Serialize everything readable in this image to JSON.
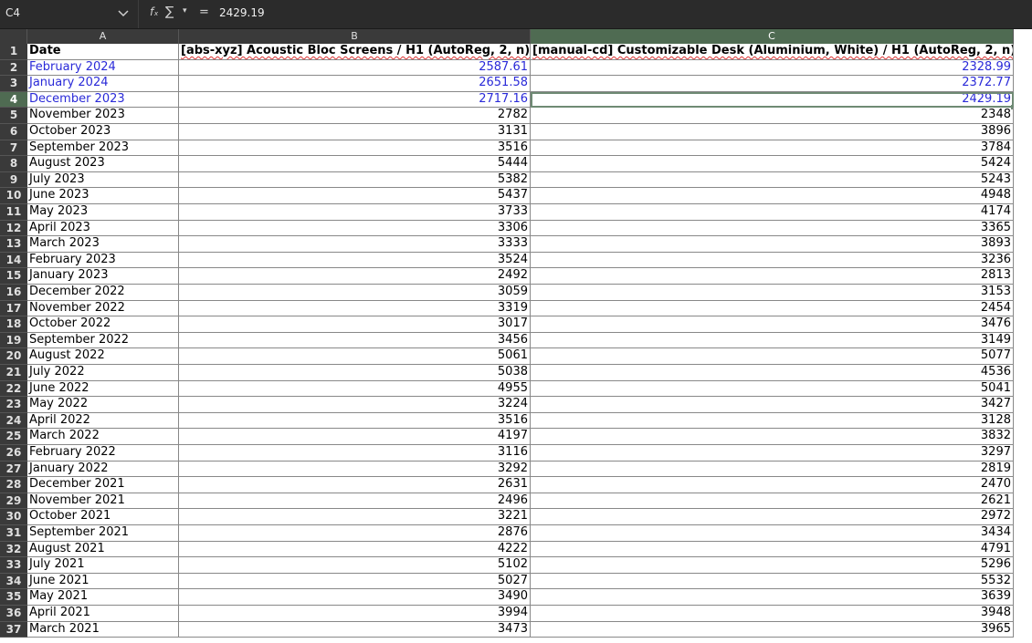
{
  "formula_bar": {
    "cell_ref": "C4",
    "fx_label": "fₓ",
    "sum_label": "∑",
    "sum_dropdown": "▾",
    "equals_label": "=",
    "formula_value": "2429.19"
  },
  "columns": [
    {
      "letter": "A",
      "selected": false
    },
    {
      "letter": "B",
      "selected": false
    },
    {
      "letter": "C",
      "selected": true
    }
  ],
  "header_row": {
    "a": "Date",
    "b": "[abs-xyz] Acoustic Bloc Screens / H1 (AutoReg, 2, n)",
    "c": "[manual-cd] Customizable Desk (Aluminium, White) / H1 (AutoReg, 2, n)"
  },
  "active_row": 4,
  "rows": [
    {
      "num": "2",
      "date": "February 2024",
      "b": "2587.61",
      "c": "2328.99",
      "blue": true
    },
    {
      "num": "3",
      "date": "January 2024",
      "b": "2651.58",
      "c": "2372.77",
      "blue": true
    },
    {
      "num": "4",
      "date": "December 2023",
      "b": "2717.16",
      "c": "2429.19",
      "blue": true
    },
    {
      "num": "5",
      "date": "November 2023",
      "b": "2782",
      "c": "2348",
      "blue": false
    },
    {
      "num": "6",
      "date": "October 2023",
      "b": "3131",
      "c": "3896",
      "blue": false
    },
    {
      "num": "7",
      "date": "September 2023",
      "b": "3516",
      "c": "3784",
      "blue": false
    },
    {
      "num": "8",
      "date": "August 2023",
      "b": "5444",
      "c": "5424",
      "blue": false
    },
    {
      "num": "9",
      "date": "July 2023",
      "b": "5382",
      "c": "5243",
      "blue": false
    },
    {
      "num": "10",
      "date": "June 2023",
      "b": "5437",
      "c": "4948",
      "blue": false
    },
    {
      "num": "11",
      "date": "May 2023",
      "b": "3733",
      "c": "4174",
      "blue": false
    },
    {
      "num": "12",
      "date": "April 2023",
      "b": "3306",
      "c": "3365",
      "blue": false
    },
    {
      "num": "13",
      "date": "March 2023",
      "b": "3333",
      "c": "3893",
      "blue": false
    },
    {
      "num": "14",
      "date": "February 2023",
      "b": "3524",
      "c": "3236",
      "blue": false
    },
    {
      "num": "15",
      "date": "January 2023",
      "b": "2492",
      "c": "2813",
      "blue": false
    },
    {
      "num": "16",
      "date": "December 2022",
      "b": "3059",
      "c": "3153",
      "blue": false
    },
    {
      "num": "17",
      "date": "November 2022",
      "b": "3319",
      "c": "2454",
      "blue": false
    },
    {
      "num": "18",
      "date": "October 2022",
      "b": "3017",
      "c": "3476",
      "blue": false
    },
    {
      "num": "19",
      "date": "September 2022",
      "b": "3456",
      "c": "3149",
      "blue": false
    },
    {
      "num": "20",
      "date": "August 2022",
      "b": "5061",
      "c": "5077",
      "blue": false
    },
    {
      "num": "21",
      "date": "July 2022",
      "b": "5038",
      "c": "4536",
      "blue": false
    },
    {
      "num": "22",
      "date": "June 2022",
      "b": "4955",
      "c": "5041",
      "blue": false
    },
    {
      "num": "23",
      "date": "May 2022",
      "b": "3224",
      "c": "3427",
      "blue": false
    },
    {
      "num": "24",
      "date": "April 2022",
      "b": "3516",
      "c": "3128",
      "blue": false
    },
    {
      "num": "25",
      "date": "March 2022",
      "b": "4197",
      "c": "3832",
      "blue": false
    },
    {
      "num": "26",
      "date": "February 2022",
      "b": "3116",
      "c": "3297",
      "blue": false
    },
    {
      "num": "27",
      "date": "January 2022",
      "b": "3292",
      "c": "2819",
      "blue": false
    },
    {
      "num": "28",
      "date": "December 2021",
      "b": "2631",
      "c": "2470",
      "blue": false
    },
    {
      "num": "29",
      "date": "November 2021",
      "b": "2496",
      "c": "2621",
      "blue": false
    },
    {
      "num": "30",
      "date": "October 2021",
      "b": "3221",
      "c": "2972",
      "blue": false
    },
    {
      "num": "31",
      "date": "September 2021",
      "b": "2876",
      "c": "3434",
      "blue": false
    },
    {
      "num": "32",
      "date": "August 2021",
      "b": "4222",
      "c": "4791",
      "blue": false
    },
    {
      "num": "33",
      "date": "July 2021",
      "b": "5102",
      "c": "5296",
      "blue": false
    },
    {
      "num": "34",
      "date": "June 2021",
      "b": "5027",
      "c": "5532",
      "blue": false
    },
    {
      "num": "35",
      "date": "May 2021",
      "b": "3490",
      "c": "3639",
      "blue": false
    },
    {
      "num": "36",
      "date": "April 2021",
      "b": "3994",
      "c": "3948",
      "blue": false
    },
    {
      "num": "37",
      "date": "March 2021",
      "b": "3473",
      "c": "3965",
      "blue": false
    }
  ]
}
